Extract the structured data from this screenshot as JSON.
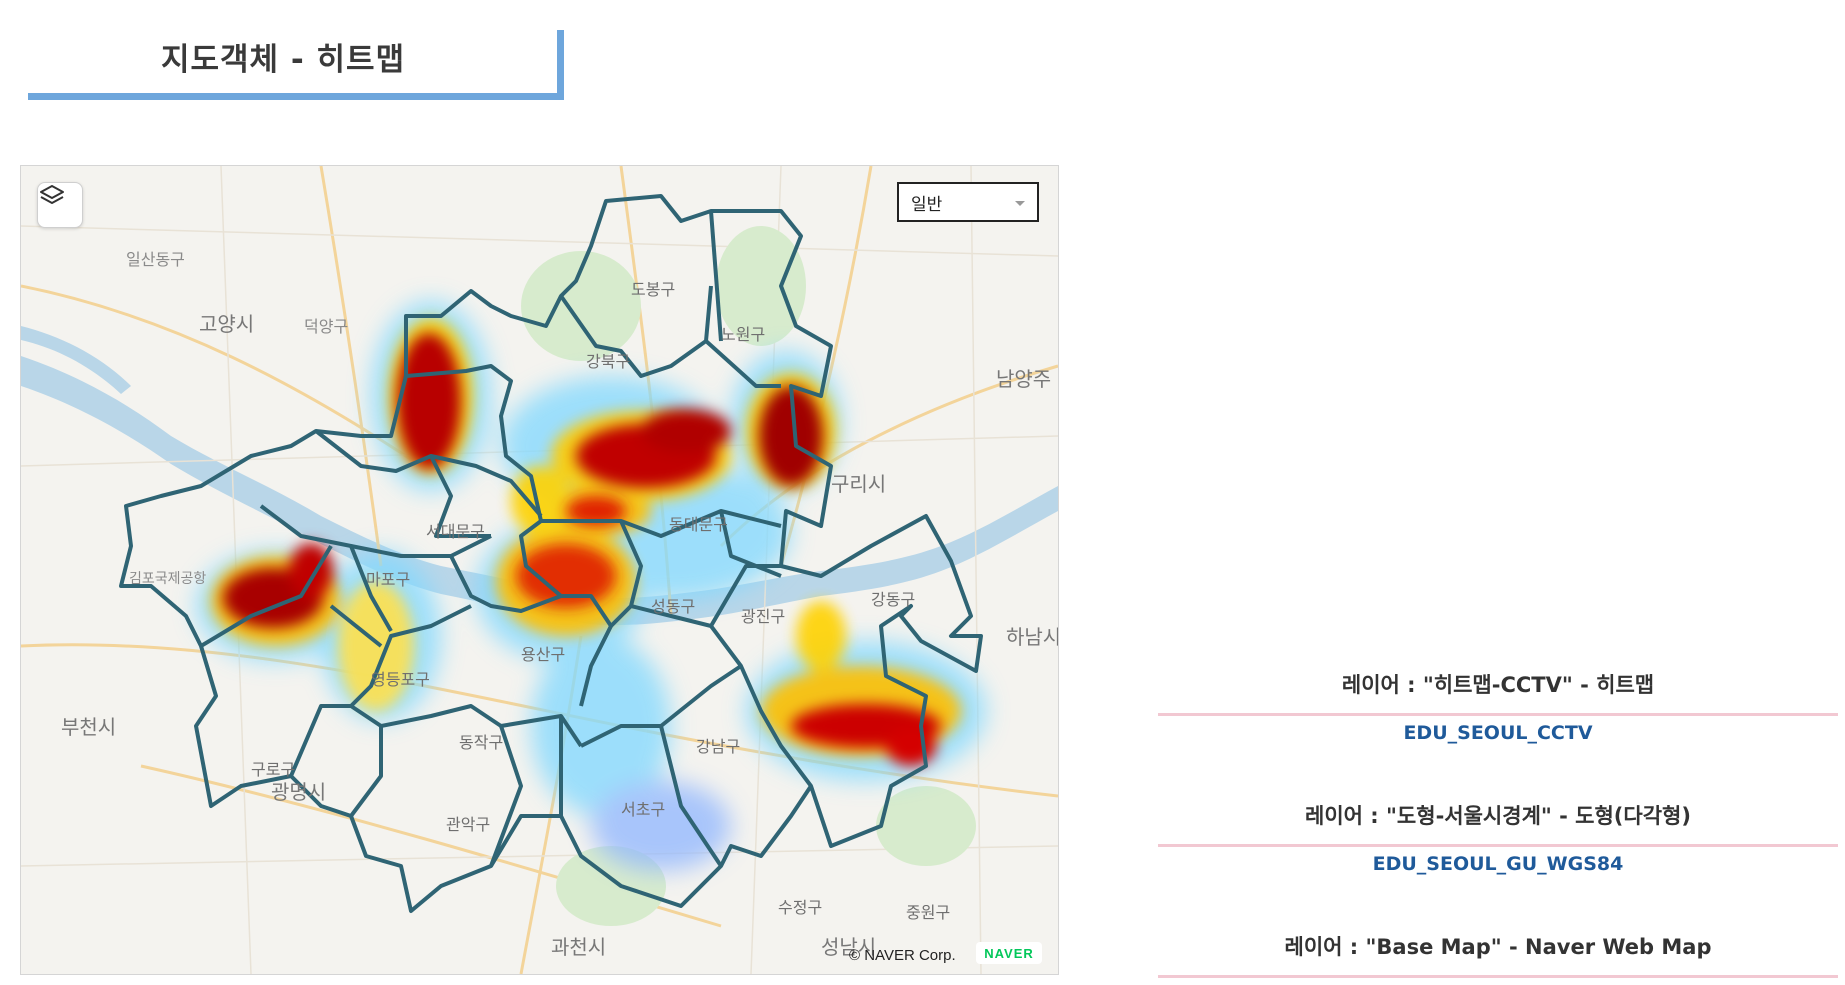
{
  "page_title": "지도객체 - 히트맵",
  "map": {
    "type_selector_value": "일반",
    "copyright": "© NAVER Corp.",
    "logo_text": "NAVER",
    "places": {
      "goyang": "고양시",
      "deogyang": "덕양구",
      "ilsan": "일산동구",
      "namyangju": "남양주",
      "guri": "구리시",
      "hanam": "하남시",
      "bucheon": "부천시",
      "gwangmyeong": "광명시",
      "gwacheon": "과천시",
      "seongnam": "성남시",
      "dobong": "도봉구",
      "nowon": "노원구",
      "gangbuk": "강북구",
      "seodaemun": "서대문구",
      "mapo": "마포구",
      "dongdaemun": "동대문구",
      "seongdong": "성동구",
      "gwangjin": "광진구",
      "gangdong": "강동구",
      "yongsan": "용산구",
      "yeongdeungpo": "영등포구",
      "guro": "구로구",
      "dongjak": "동작구",
      "gwanak": "관악구",
      "seocho": "서초구",
      "gangnam": "강남구",
      "sujeong": "수정구",
      "jungwon": "중원구",
      "gimpo_airport": "김포국제공항"
    }
  },
  "legend": [
    {
      "label": "레이어 : \"히트맵-CCTV\"   -  히트맵",
      "code": "EDU_SEOUL_CCTV"
    },
    {
      "label": "레이어 : \"도형-서울시경계\"   - 도형(다각형)",
      "code": "EDU_SEOUL_GU_WGS84"
    },
    {
      "label": "레이어 : \"Base Map\"   -  Naver Web Map",
      "code": ""
    }
  ],
  "colors": {
    "accent": "#6ea6dc",
    "boundary": "#2f6474",
    "legend_rule": "#f2c8d2",
    "code_text": "#1f5a9a",
    "heat_hot": "#b00000",
    "heat_cool": "#6fd3ff"
  }
}
